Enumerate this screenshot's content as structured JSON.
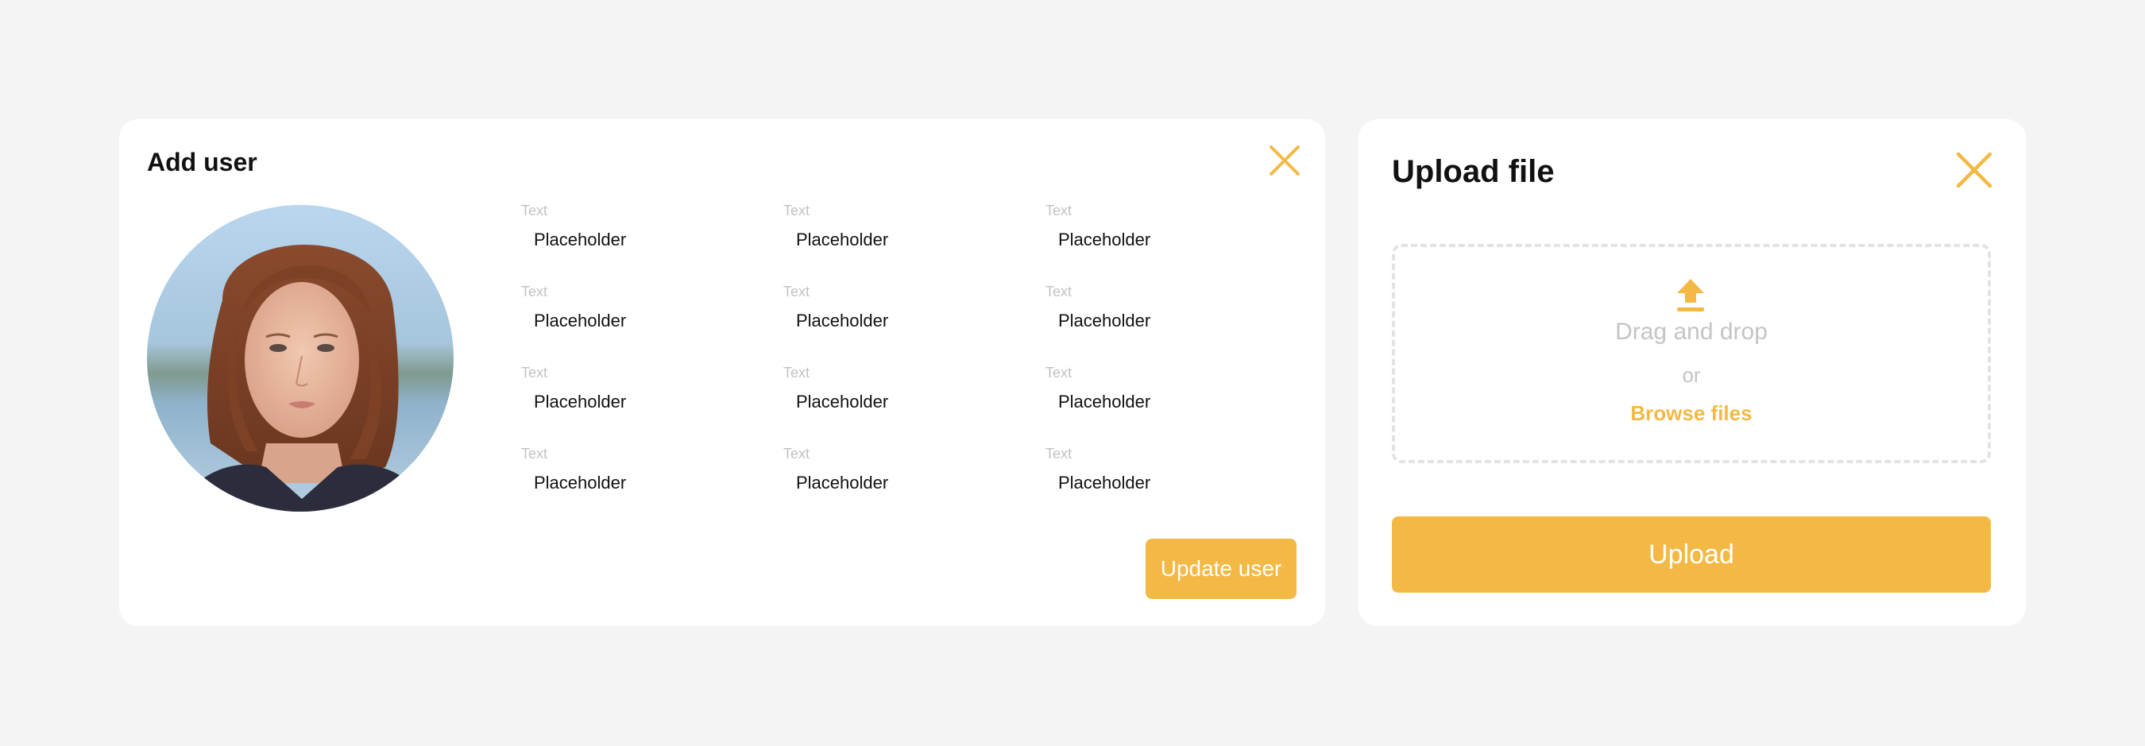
{
  "colors": {
    "accent": "#f4b944",
    "background": "#f4f4f4",
    "card": "#ffffff",
    "label": "#c2c2c2",
    "muted_text": "#c4c4c4"
  },
  "add_user": {
    "title": "Add user",
    "close_icon": "close-icon",
    "avatar_alt": "user avatar photo",
    "fields": [
      {
        "label": "Text",
        "value": "Placeholder"
      },
      {
        "label": "Text",
        "value": "Placeholder"
      },
      {
        "label": "Text",
        "value": "Placeholder"
      },
      {
        "label": "Text",
        "value": "Placeholder"
      },
      {
        "label": "Text",
        "value": "Placeholder"
      },
      {
        "label": "Text",
        "value": "Placeholder"
      },
      {
        "label": "Text",
        "value": "Placeholder"
      },
      {
        "label": "Text",
        "value": "Placeholder"
      },
      {
        "label": "Text",
        "value": "Placeholder"
      },
      {
        "label": "Text",
        "value": "Placeholder"
      },
      {
        "label": "Text",
        "value": "Placeholder"
      },
      {
        "label": "Text",
        "value": "Placeholder"
      }
    ],
    "submit_label": "Update user"
  },
  "upload_file": {
    "title": "Upload file",
    "close_icon": "close-icon",
    "dropzone": {
      "icon": "upload-icon",
      "primary_text": "Drag and drop",
      "separator_text": "or",
      "browse_label": "Browse files"
    },
    "submit_label": "Upload"
  }
}
